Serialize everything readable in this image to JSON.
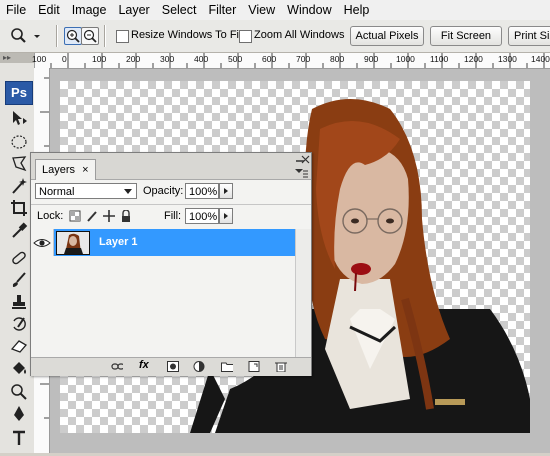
{
  "menu": [
    "File",
    "Edit",
    "Image",
    "Layer",
    "Select",
    "Filter",
    "View",
    "Window",
    "Help"
  ],
  "options": {
    "resize_windows": "Resize Windows To Fit",
    "zoom_all": "Zoom All Windows",
    "actual_pixels": "Actual Pixels",
    "fit_screen": "Fit Screen",
    "print_size": "Print Siz"
  },
  "toolbox": {
    "logo": "Ps"
  },
  "ruler": {
    "top": [
      "100",
      "0",
      "100",
      "200",
      "300",
      "400",
      "500",
      "600",
      "700",
      "800",
      "900",
      "1000",
      "1100",
      "1200",
      "1300",
      "1400"
    ]
  },
  "layers_panel": {
    "tab": "Layers",
    "blend_mode": "Normal",
    "opacity_label": "Opacity:",
    "opacity_value": "100%",
    "lock_label": "Lock:",
    "fill_label": "Fill:",
    "fill_value": "100%",
    "layers": [
      {
        "name": "Layer 1",
        "visible": true,
        "selected": true
      }
    ]
  },
  "colors": {
    "selection": "#3399ff",
    "ps_logo": "#2b5aa6"
  }
}
